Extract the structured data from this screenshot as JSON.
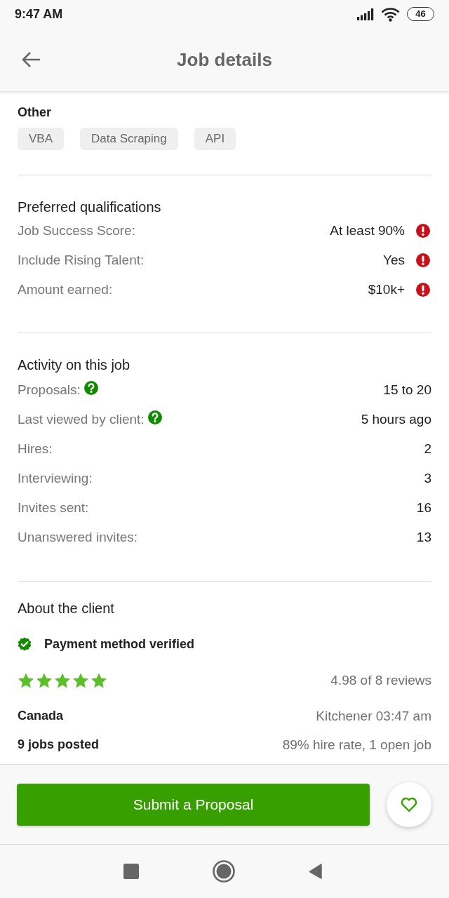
{
  "status_bar": {
    "time": "9:47 AM",
    "battery": "46"
  },
  "app_bar": {
    "title": "Job details"
  },
  "skills": {
    "heading": "Other",
    "tags": [
      "VBA",
      "Data Scraping",
      "API"
    ]
  },
  "qualifications": {
    "heading": "Preferred qualifications",
    "rows": [
      {
        "label": "Job Success Score:",
        "value": "At least 90%",
        "unmet": true
      },
      {
        "label": "Include Rising Talent:",
        "value": "Yes",
        "unmet": true
      },
      {
        "label": "Amount earned:",
        "value": "$10k+",
        "unmet": true
      }
    ]
  },
  "activity": {
    "heading": "Activity on this job",
    "rows": [
      {
        "label": "Proposals:",
        "value": "15 to 20",
        "help": true
      },
      {
        "label": "Last viewed by client:",
        "value": "5 hours ago",
        "help": true
      },
      {
        "label": "Hires:",
        "value": "2",
        "help": false
      },
      {
        "label": "Interviewing:",
        "value": "3",
        "help": false
      },
      {
        "label": "Invites sent:",
        "value": "16",
        "help": false
      },
      {
        "label": "Unanswered invites:",
        "value": "13",
        "help": false
      }
    ]
  },
  "client": {
    "heading": "About the client",
    "payment": "Payment method verified",
    "payment_verified": true,
    "stars": 5,
    "rating": "4.98 of 8 reviews",
    "details": [
      {
        "label": "Canada",
        "value": "Kitchener 03:47 am"
      },
      {
        "label": "9 jobs posted",
        "value": "89% hire rate, 1 open job"
      }
    ]
  },
  "footer": {
    "submit": "Submit a Proposal",
    "saved": false
  }
}
